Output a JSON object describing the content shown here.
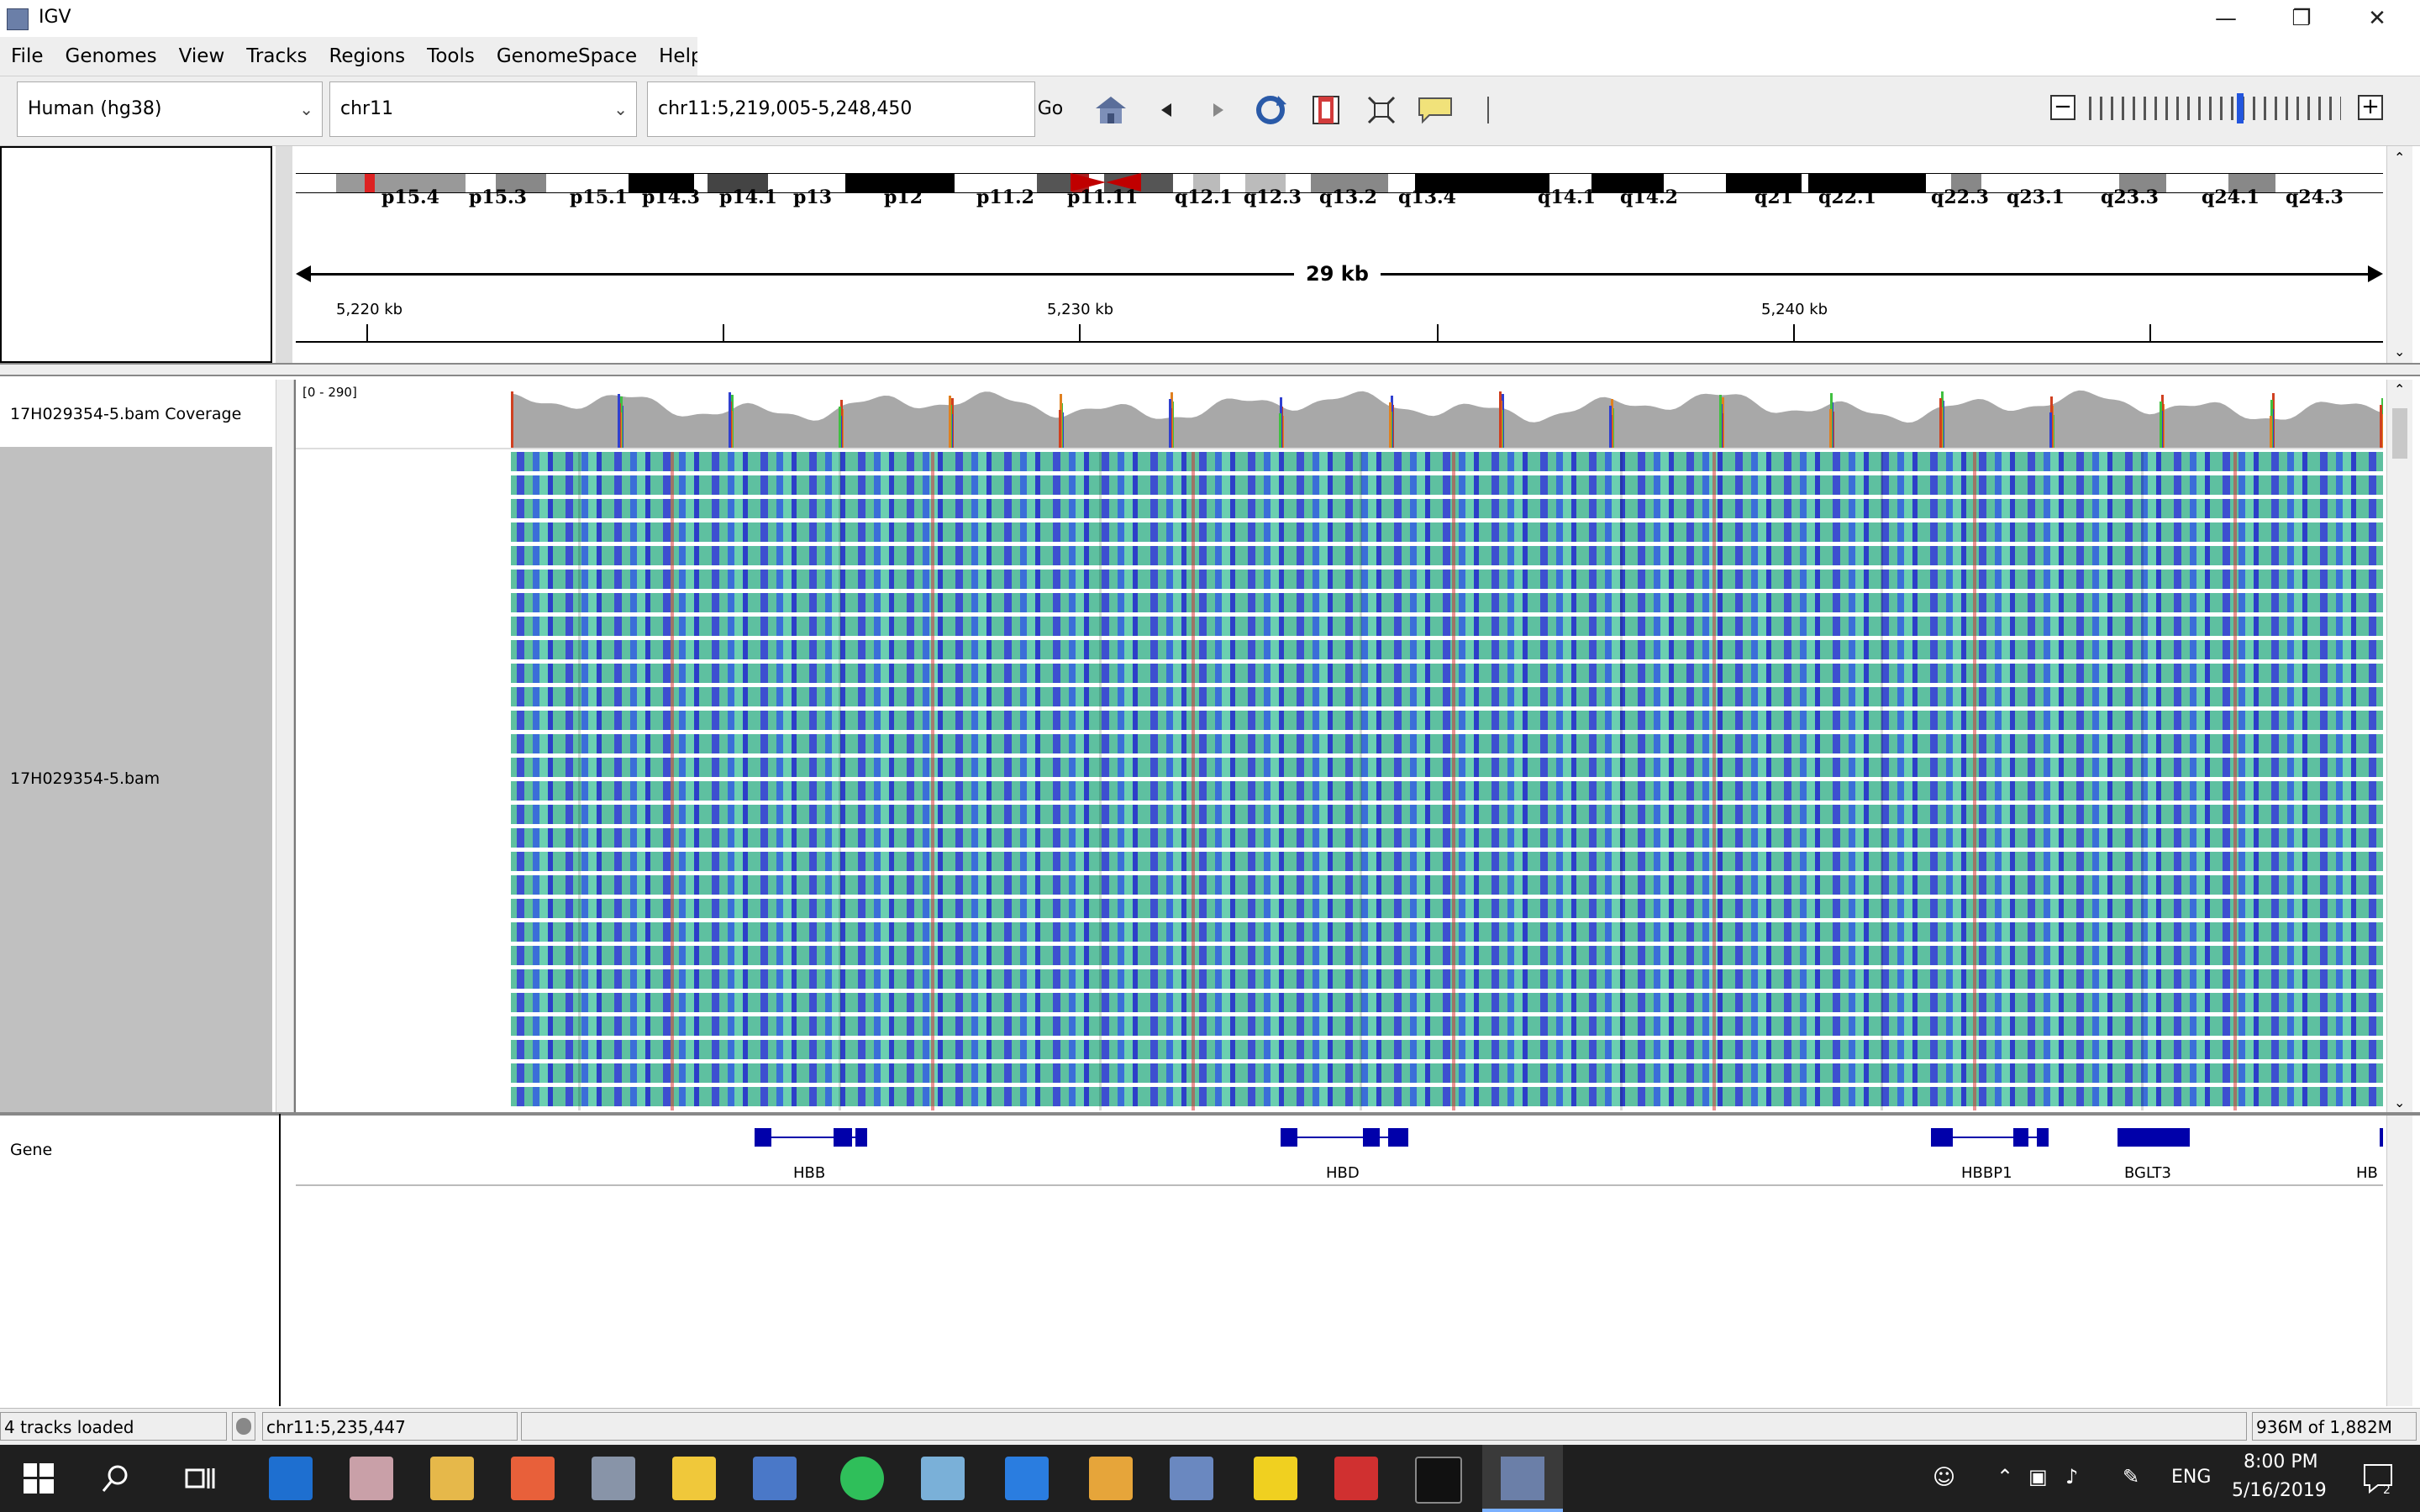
{
  "window": {
    "title": "IGV"
  },
  "menu": [
    "File",
    "Genomes",
    "View",
    "Tracks",
    "Regions",
    "Tools",
    "GenomeSpace",
    "Help"
  ],
  "toolbar": {
    "genome": "Human (hg38)",
    "chromosome": "chr11",
    "locus": "chr11:5,219,005-5,248,450",
    "go_label": "Go"
  },
  "ideogram": {
    "bands": [
      "p15.4",
      "p15.3",
      "p15.1",
      "p14.3",
      "p14.1",
      "p13",
      "p12",
      "p11.2",
      "p11.11",
      "q12.1",
      "q12.3",
      "q13.2",
      "q13.4",
      "q14.1",
      "q14.2",
      "q21",
      "q22.1",
      "q22.3",
      "q23.1",
      "q23.3",
      "q24.1",
      "q24.3"
    ]
  },
  "ruler": {
    "span_label": "29 kb",
    "labels": [
      "5,220 kb",
      "5,230 kb",
      "5,240 kb"
    ]
  },
  "tracks": {
    "coverage_name": "17H029354-5.bam Coverage",
    "coverage_range": "[0 - 290]",
    "bam_name": "17H029354-5.bam",
    "gene_name": "Gene"
  },
  "genes": [
    "HBB",
    "HBD",
    "HBBP1",
    "BGLT3",
    "HB"
  ],
  "status": {
    "tracks_loaded": "4 tracks loaded",
    "position": "chr11:5,235,447",
    "memory": "936M of 1,882M"
  },
  "taskbar": {
    "language": "ENG",
    "time": "8:00 PM",
    "date": "5/16/2019"
  },
  "colors": {
    "read_teal": "#5ec0a0",
    "read_blue": "#3d4fd0",
    "coverage_gray": "#a8a8a8",
    "gene_blue": "#0000aa",
    "centromere_red": "#c00000"
  },
  "icons": [
    "home-icon",
    "back-icon",
    "forward-icon",
    "refresh-icon",
    "region-of-interest-icon",
    "resize-icon",
    "popup-info-icon",
    "zoom-minus-icon",
    "zoom-plus-icon"
  ]
}
